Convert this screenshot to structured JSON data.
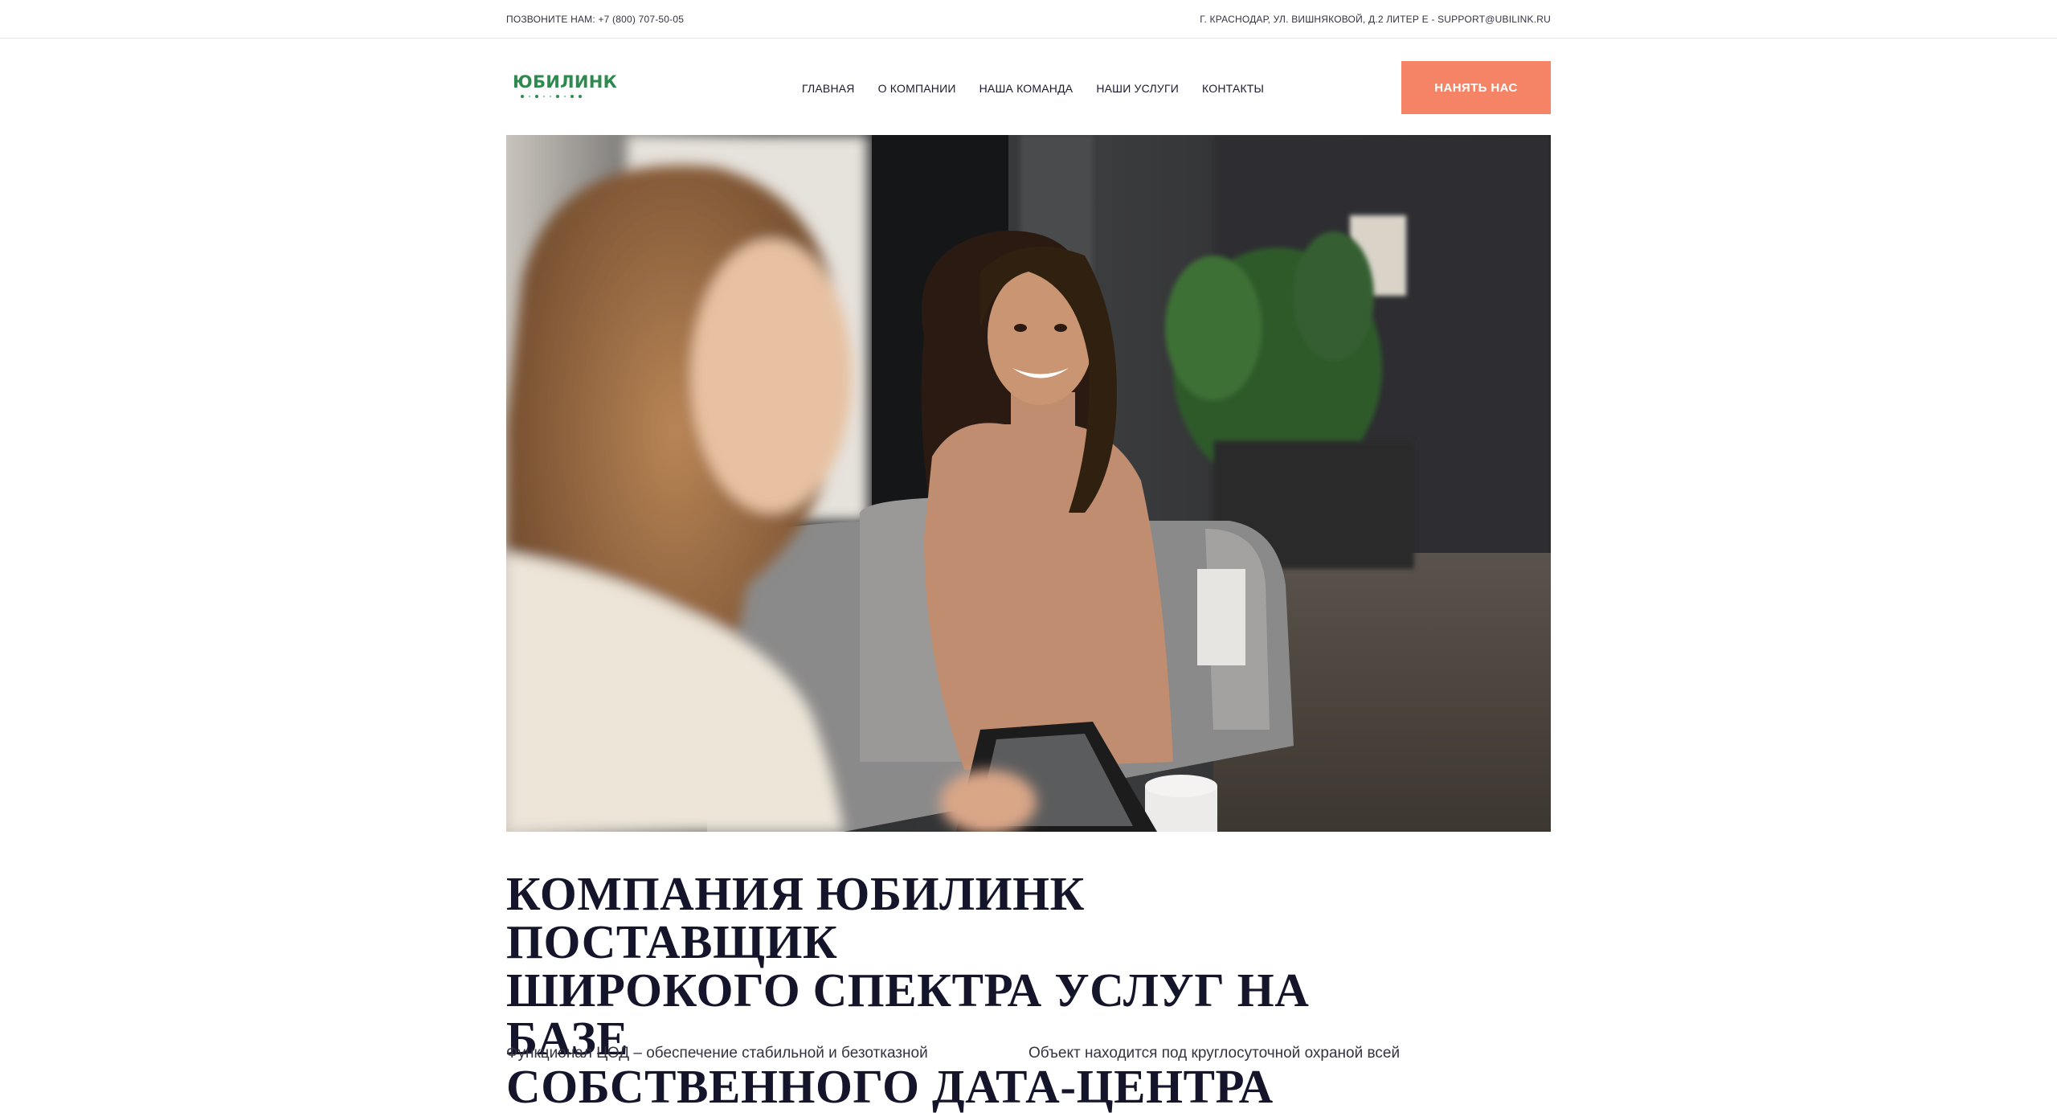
{
  "topbar": {
    "phone": "ПОЗВОНИТЕ НАМ: +7 (800) 707-50-05",
    "address": "Г. КРАСНОДАР, УЛ. ВИШНЯКОВОЙ, Д.2 ЛИТЕР Е - SUPPORT@UBILINK.RU"
  },
  "logo": {
    "text": "ЮБИЛИНК"
  },
  "nav": {
    "items": [
      {
        "label": "ГЛАВНАЯ"
      },
      {
        "label": "О КОМПАНИИ"
      },
      {
        "label": "НАША КОМАНДА"
      },
      {
        "label": "НАШИ УСЛУГИ"
      },
      {
        "label": "КОНТАКТЫ"
      }
    ]
  },
  "cta": {
    "label": "НАНЯТЬ НАС"
  },
  "hero": {
    "icon": "photo-two-women-talking"
  },
  "headline": {
    "lines": [
      "КОМПАНИЯ ЮБИЛИНК ПОСТАВЩИК",
      "ШИРОКОГО СПЕКТРА УСЛУГ НА БАЗЕ",
      "СОБСТВЕННОГО ДАТА-ЦЕНТРА"
    ]
  },
  "columns": {
    "left": "Функционал ЦОД – обеспечение стабильной и безотказной",
    "right": "Объект находится под круглосуточной охраной всей"
  },
  "colors": {
    "accent": "#f48465",
    "brand_green": "#2e8a4e",
    "heading": "#14142b"
  }
}
